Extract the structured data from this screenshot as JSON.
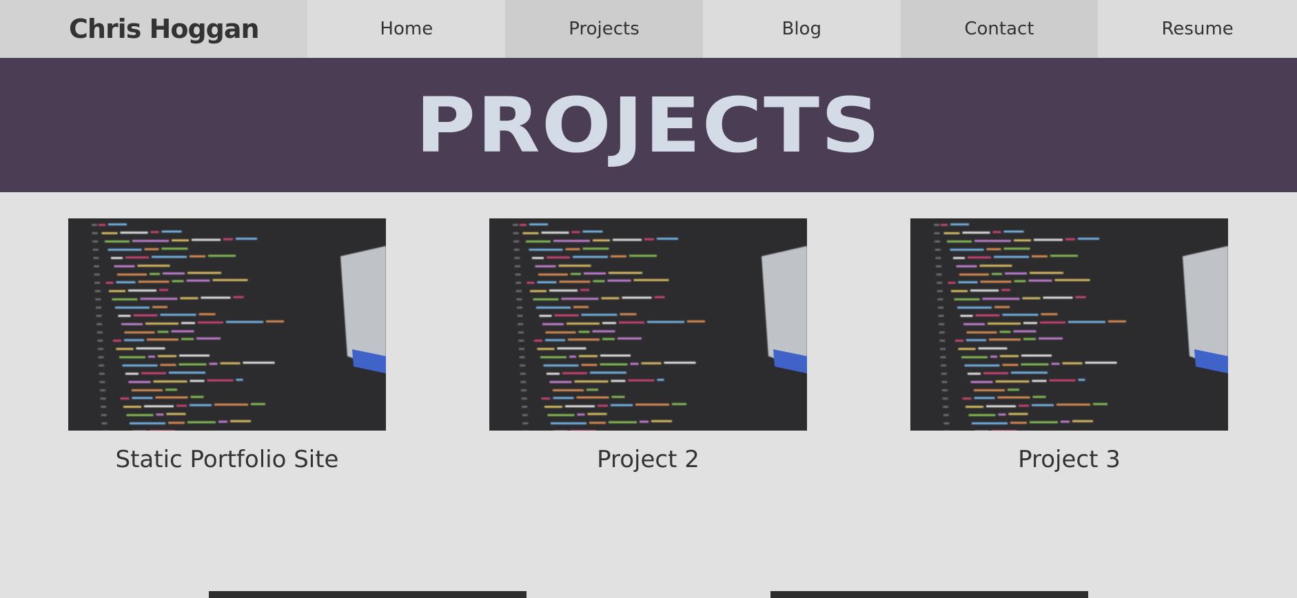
{
  "brand": {
    "name": "Chris Hoggan"
  },
  "nav": {
    "items": [
      {
        "label": "Home"
      },
      {
        "label": "Projects"
      },
      {
        "label": "Blog"
      },
      {
        "label": "Contact"
      },
      {
        "label": "Resume"
      }
    ]
  },
  "hero": {
    "title": "PROJECTS"
  },
  "projects": [
    {
      "title": "Static Portfolio Site"
    },
    {
      "title": "Project 2"
    },
    {
      "title": "Project 3"
    }
  ],
  "colors": {
    "page_bg": "#e1e1e1",
    "hero_bg": "#4b3d54",
    "hero_text": "#d3dce6",
    "text": "#333333"
  }
}
